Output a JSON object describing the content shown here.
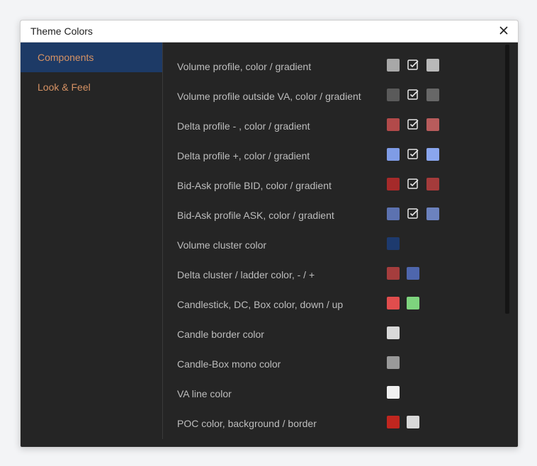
{
  "dialog": {
    "title": "Theme Colors"
  },
  "sidebar": {
    "items": [
      {
        "label": "Components",
        "active": true
      },
      {
        "label": "Look & Feel",
        "active": false
      }
    ]
  },
  "rows": [
    {
      "label": "Volume profile, color / gradient",
      "color1": "#a8a8a8",
      "gradient": true,
      "color2": "#b9b9b9"
    },
    {
      "label": "Volume profile outside VA, color / gradient",
      "color1": "#5a5a5a",
      "gradient": true,
      "color2": "#676767"
    },
    {
      "label": "Delta profile - , color / gradient",
      "color1": "#b24a4a",
      "gradient": true,
      "color2": "#b85c5c"
    },
    {
      "label": "Delta profile +, color / gradient",
      "color1": "#7f9ce6",
      "gradient": true,
      "color2": "#8aa6ef"
    },
    {
      "label": "Bid-Ask profile BID, color / gradient",
      "color1": "#a52a2a",
      "gradient": true,
      "color2": "#a43b3b"
    },
    {
      "label": "Bid-Ask profile ASK, color / gradient",
      "color1": "#5c72b0",
      "gradient": true,
      "color2": "#6c82be"
    },
    {
      "label": "Volume cluster color",
      "color1": "#1d3a6e"
    },
    {
      "label": "Delta cluster / ladder color, - / +",
      "color1": "#a53d3d",
      "color2": "#4e66ad"
    },
    {
      "label": "Candlestick, DC, Box color, down / up",
      "color1": "#e04d4d",
      "color2": "#7ed47e"
    },
    {
      "label": "Candle border color",
      "color1": "#d9d9d9"
    },
    {
      "label": "Candle-Box mono color",
      "color1": "#999999"
    },
    {
      "label": "VA line color",
      "color1": "#f0f0f0"
    },
    {
      "label": "POC color, background / border",
      "color1": "#c0261f",
      "color2": "#d9d9d9"
    }
  ]
}
